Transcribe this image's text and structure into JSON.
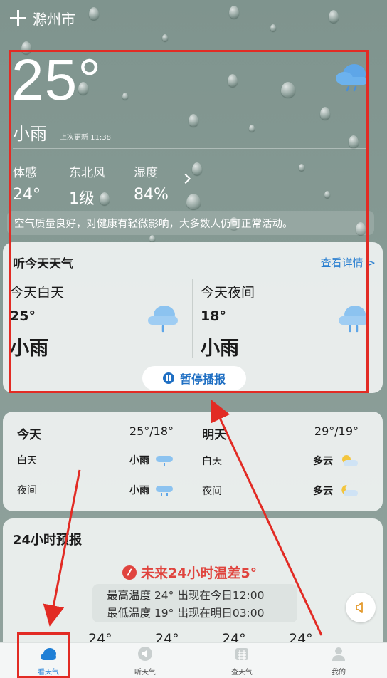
{
  "header": {
    "city": "滁州市"
  },
  "current": {
    "temperature": "25°",
    "condition": "小雨",
    "updated": "上次更新 11:38",
    "metrics": [
      {
        "key": "体感",
        "value": "24°"
      },
      {
        "key": "东北风",
        "value": "1级"
      },
      {
        "key": "湿度",
        "value": "84%"
      }
    ],
    "air_quality": "空气质量良好，对健康有轻微影响，大多数人仍可正常活动。"
  },
  "listen_card": {
    "title": "听今天天气",
    "more": "查看详情 >",
    "day": {
      "label": "今天白天",
      "temp": "25°",
      "condition": "小雨"
    },
    "night": {
      "label": "今天夜间",
      "temp": "18°",
      "condition": "小雨"
    },
    "pause_label": "暂停播报"
  },
  "daily": [
    {
      "day": "今天",
      "range": "25°/18°",
      "rows": [
        {
          "k": "白天",
          "v": "小雨"
        },
        {
          "k": "夜间",
          "v": "小雨"
        }
      ]
    },
    {
      "day": "明天",
      "range": "29°/19°",
      "rows": [
        {
          "k": "白天",
          "v": "多云"
        },
        {
          "k": "夜间",
          "v": "多云"
        }
      ]
    }
  ],
  "hourly": {
    "title": "24小时预报",
    "warning": "未来24小时温差5°",
    "max_line": "最高温度 24° 出现在今日12:00",
    "min_line": "最低温度 19° 出现在明日03:00",
    "temps": [
      "24°",
      "24°",
      "24°",
      "24°"
    ]
  },
  "tabs": [
    {
      "label": "看天气",
      "icon": "cloud-icon",
      "active": true
    },
    {
      "label": "听天气",
      "icon": "speaker-icon"
    },
    {
      "label": "查天气",
      "icon": "calendar-icon"
    },
    {
      "label": "我的",
      "icon": "person-icon"
    }
  ],
  "colors": {
    "accent": "#1f7fd6",
    "warning": "#e0443e",
    "annotation": "#e22b24"
  }
}
